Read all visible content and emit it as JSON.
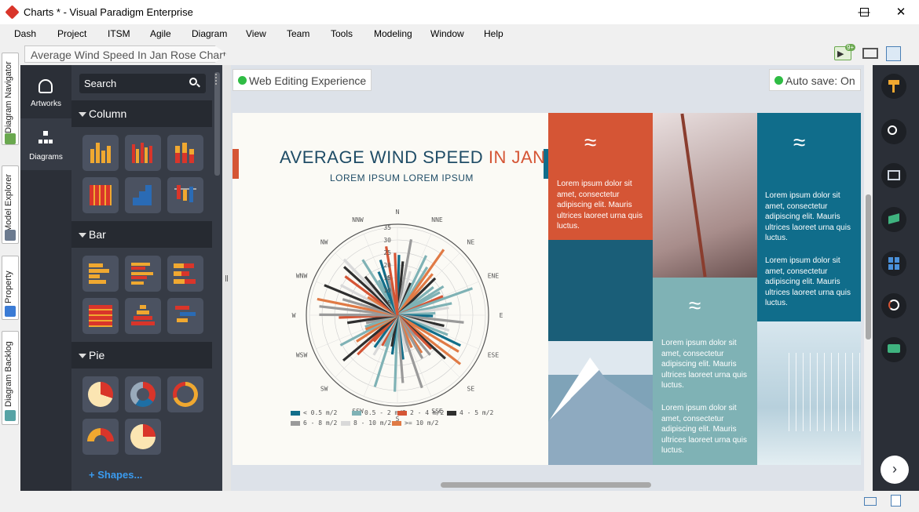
{
  "window": {
    "title": "Charts * - Visual Paradigm Enterprise"
  },
  "menu": [
    "Dash",
    "Project",
    "ITSM",
    "Agile",
    "Diagram",
    "View",
    "Team",
    "Tools",
    "Modeling",
    "Window",
    "Help"
  ],
  "breadcrumb": "Average Wind Speed In Jan Rose Chart",
  "notification_badge": "9+",
  "left_tabs": [
    "Diagram Navigator",
    "Model Explorer",
    "Property",
    "Diagram Backlog"
  ],
  "nav": {
    "artworks": "Artworks",
    "diagrams": "Diagrams"
  },
  "palette": {
    "search_placeholder": "Search",
    "sections": [
      "Column",
      "Bar",
      "Pie"
    ],
    "shapes_button": "Shapes..."
  },
  "status": {
    "web_editing": "Web Editing Experience",
    "autosave": "Auto save: On"
  },
  "infographic": {
    "title_main": "AVERAGE WIND SPEED",
    "title_accent": "IN JAN",
    "subtitle": "LOREM IPSUM LOREM IPSUM",
    "lorem": "Lorem ipsum dolor sit amet, consectetur adipiscing elit. Mauris ultrices laoreet urna quis luctus."
  },
  "chart_data": {
    "type": "rose",
    "directions": [
      "N",
      "NNE",
      "NE",
      "ENE",
      "E",
      "ESE",
      "SE",
      "SSE",
      "S",
      "SSW",
      "SW",
      "WSW",
      "W",
      "WNW",
      "NW",
      "NNW"
    ],
    "radial_ticks": [
      "5",
      "10",
      "15",
      "20",
      "25",
      "30",
      "35"
    ],
    "legend": [
      {
        "name": "< 0.5 m/2",
        "color": "#116e8a"
      },
      {
        "name": "0.5 - 2 m/2",
        "color": "#7fb2b5"
      },
      {
        "name": "2 - 4 m/2",
        "color": "#d55535"
      },
      {
        "name": "4 - 5 m/2",
        "color": "#2f2f2f"
      },
      {
        "name": "6 - 8 m/2",
        "color": "#9a9a9a"
      },
      {
        "name": "8 - 10 m/2",
        "color": "#d9d9d9"
      },
      {
        "name": ">= 10 m/2",
        "color": "#e07a45"
      }
    ]
  },
  "colors": {
    "orange": "#d55535",
    "teal": "#106d8b",
    "sage": "#7fb2b5",
    "dark": "#2b2f37"
  }
}
